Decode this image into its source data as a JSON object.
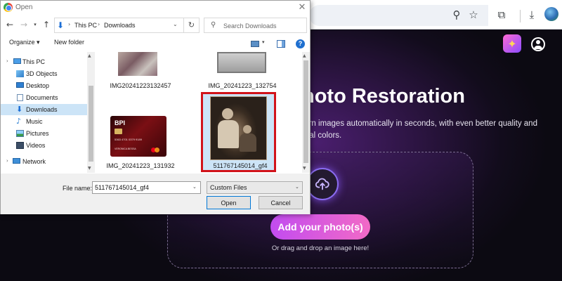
{
  "browser": {
    "icons": [
      "zoom-icon",
      "star-icon",
      "extensions-icon",
      "download-icon",
      "profile-avatar"
    ]
  },
  "page": {
    "title": "hoto Restoration",
    "description": "torn images automatically in seconds, with even better quality and ural colors.",
    "upload_button": "Add your photo(s)",
    "drag_hint": "Or drag and drop an image here!",
    "colors": {
      "button_start": "#c24cf0",
      "button_end": "#f26ac6",
      "accent": "#8a6cf0"
    }
  },
  "dialog": {
    "title": "Open",
    "close_glyph": "✕",
    "address": {
      "root": "This PC",
      "folder": "Downloads"
    },
    "search_placeholder": "Search Downloads",
    "toolbar": {
      "organize": "Organize ▾",
      "new_folder": "New folder",
      "help": "?"
    },
    "nav_items": [
      {
        "label": "This PC",
        "icon": "computer-icon",
        "selected": false
      },
      {
        "label": "3D Objects",
        "icon": "cube-icon",
        "selected": false
      },
      {
        "label": "Desktop",
        "icon": "desktop-icon",
        "selected": false
      },
      {
        "label": "Documents",
        "icon": "documents-icon",
        "selected": false
      },
      {
        "label": "Downloads",
        "icon": "download-arrow-icon",
        "selected": true
      },
      {
        "label": "Music",
        "icon": "music-icon",
        "selected": false
      },
      {
        "label": "Pictures",
        "icon": "pictures-icon",
        "selected": false
      },
      {
        "label": "Videos",
        "icon": "videos-icon",
        "selected": false
      },
      {
        "label": "Network",
        "icon": "network-icon",
        "selected": false
      }
    ],
    "files": [
      {
        "name": "IMG20241223132457"
      },
      {
        "name": "IMG_20241223_132754"
      },
      {
        "name": "IMG_20241223_131932",
        "card_text": "BPI",
        "card_number": "5363 4701 0379 9189",
        "card_holder": "VERONICA BESSA"
      },
      {
        "name": "511767145014_gf4",
        "selected": true
      }
    ],
    "file_name_label": "File name:",
    "file_name_value": "511767145014_gf4",
    "file_type": "Custom Files",
    "open_label": "Open",
    "cancel_label": "Cancel",
    "selection_color": "#d1131a"
  }
}
